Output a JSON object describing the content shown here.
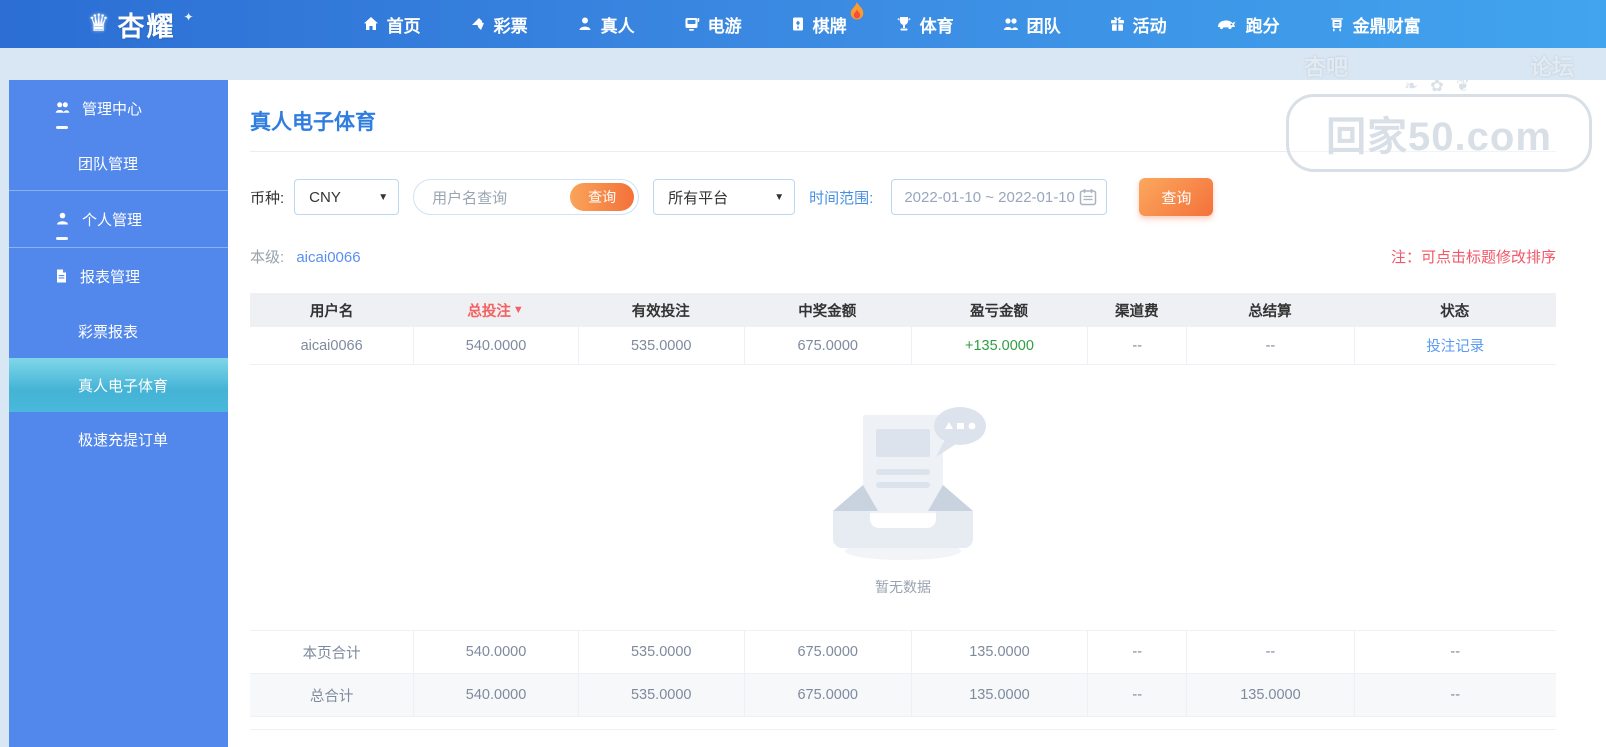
{
  "nav": {
    "logo_text": "杏耀",
    "items": [
      {
        "label": "首页",
        "icon": "home-icon"
      },
      {
        "label": "彩票",
        "icon": "lottery-icon"
      },
      {
        "label": "真人",
        "icon": "live-person-icon"
      },
      {
        "label": "电游",
        "icon": "egame-icon"
      },
      {
        "label": "棋牌",
        "icon": "chess-card-icon",
        "badge": "flame-icon"
      },
      {
        "label": "体育",
        "icon": "sports-trophy-icon"
      },
      {
        "label": "团队",
        "icon": "team-icon"
      },
      {
        "label": "活动",
        "icon": "activity-gift-icon"
      },
      {
        "label": "跑分",
        "icon": "paofen-rhino-icon"
      },
      {
        "label": "金鼎财富",
        "icon": "wealth-ding-icon"
      }
    ]
  },
  "sidebar": {
    "groups": [
      {
        "header": {
          "label": "管理中心",
          "icon": "users-icon"
        },
        "children": [
          {
            "label": "团队管理"
          }
        ]
      },
      {
        "header": {
          "label": "个人管理",
          "icon": "user-icon"
        },
        "children": []
      },
      {
        "header": {
          "label": "报表管理",
          "icon": "report-icon"
        },
        "children": [
          {
            "label": "彩票报表"
          },
          {
            "label": "真人电子体育",
            "active": true
          },
          {
            "label": "极速充提订单"
          }
        ]
      }
    ]
  },
  "main": {
    "page_title": "真人电子体育",
    "filters": {
      "currency_label": "币种:",
      "currency_value": "CNY",
      "username_placeholder": "用户名查询",
      "username_search_button": "查询",
      "platform_value": "所有平台",
      "date_label": "时间范围:",
      "date_value": "2022-01-10 ~ 2022-01-10",
      "search_button": "查询"
    },
    "level_label": "本级:",
    "level_value": "aicai0066",
    "sort_note": "注：可点击标题修改排序",
    "table": {
      "headers": [
        "用户名",
        "总投注",
        "有效投注",
        "中奖金额",
        "盈亏金额",
        "渠道费",
        "总结算",
        "状态"
      ],
      "sort_indicator": "▼",
      "row": {
        "username": "aicai0066",
        "total_bet": "540.0000",
        "valid_bet": "535.0000",
        "win_amount": "675.0000",
        "profit": "+135.0000",
        "channel_fee": "--",
        "settlement": "--",
        "status_link": "投注记录"
      },
      "empty_text": "暂无数据",
      "page_total": {
        "label": "本页合计",
        "values": [
          "540.0000",
          "535.0000",
          "675.0000",
          "135.0000",
          "--",
          "--",
          "--"
        ]
      },
      "grand_total": {
        "label": "总合计",
        "values": [
          "540.0000",
          "535.0000",
          "675.0000",
          "135.0000",
          "--",
          "135.0000",
          "--"
        ]
      }
    }
  },
  "watermark": {
    "top_left": "杏吧",
    "top_right": "论坛",
    "ornament": "❧ ✿ ❦",
    "main_text": "回家50.com"
  },
  "colors": {
    "nav_blue": "#3b8ae2",
    "sidebar_blue": "#5287eb",
    "active_cyan": "#44b3d6",
    "title_blue": "#2f7de0",
    "link_blue": "#5a9af5",
    "note_red": "#f25668",
    "sorted_red": "#f56060",
    "profit_green": "#2f9e44",
    "button_orange": "#f4713a"
  }
}
